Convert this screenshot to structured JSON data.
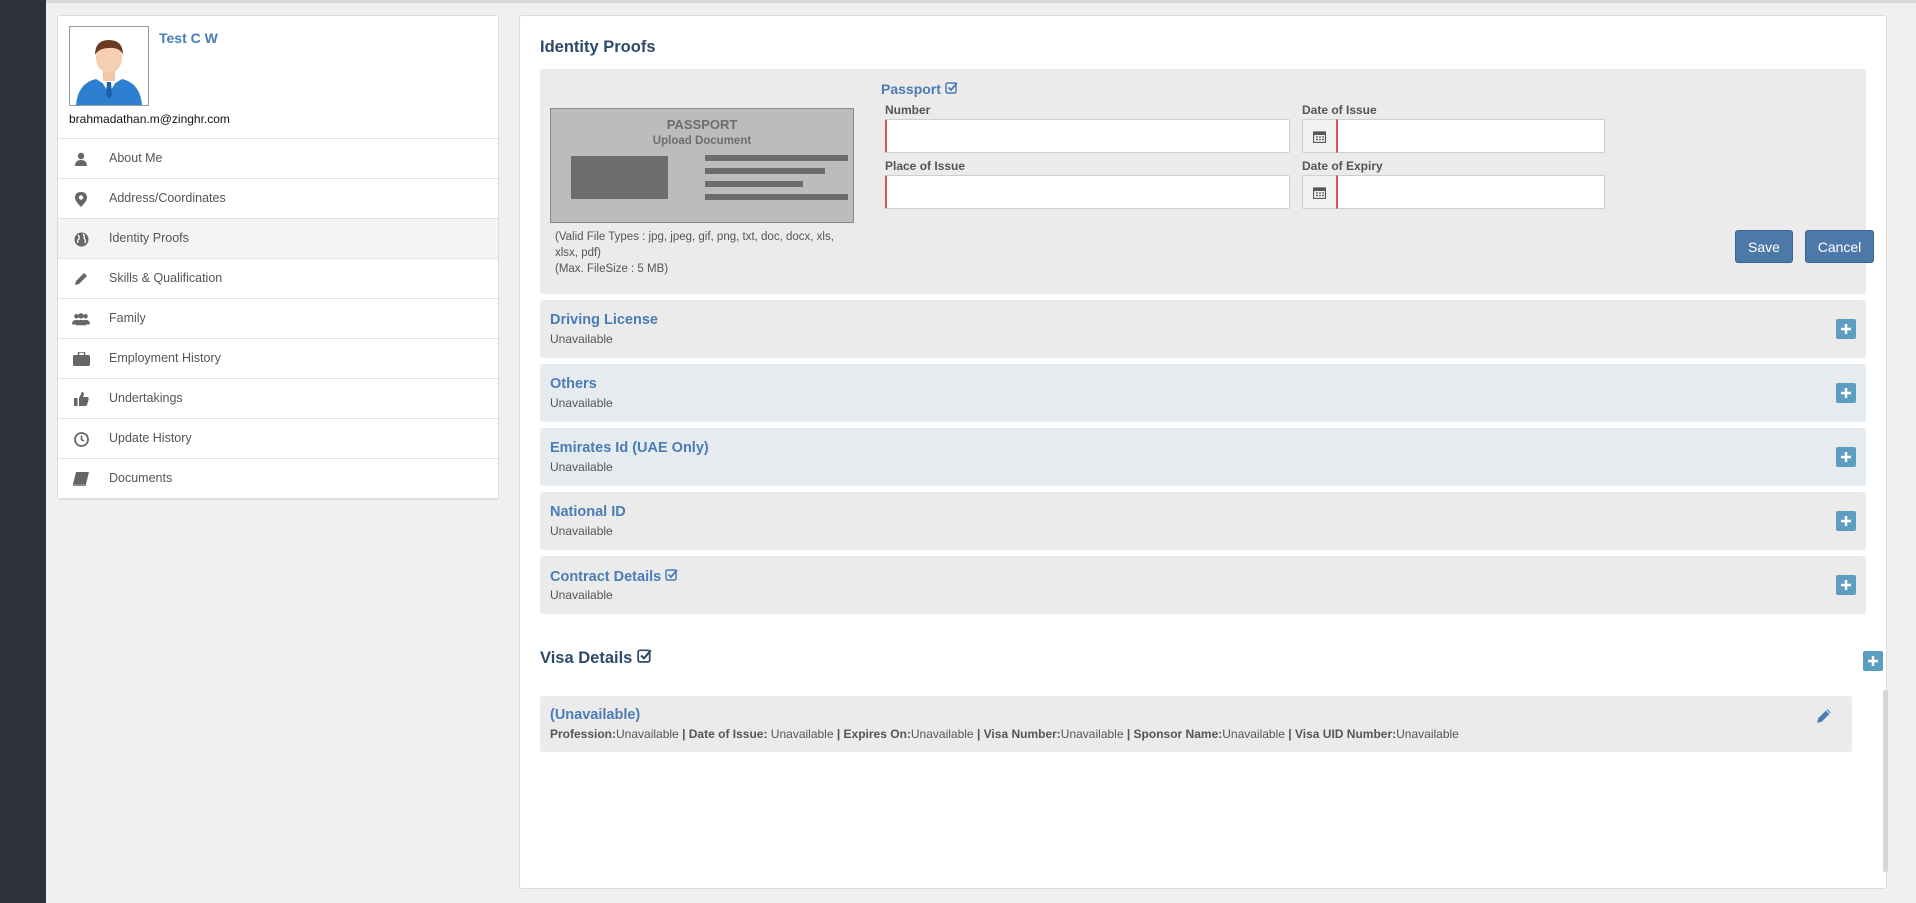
{
  "profile": {
    "name": "Test C W",
    "email": "brahmadathan.m@zinghr.com",
    "menu": [
      {
        "label": "About Me",
        "icon": "user-icon"
      },
      {
        "label": "Address/Coordinates",
        "icon": "map-marker-icon"
      },
      {
        "label": "Identity Proofs",
        "icon": "globe-icon",
        "active": true
      },
      {
        "label": "Skills & Qualification",
        "icon": "pencil-icon"
      },
      {
        "label": "Family",
        "icon": "users-icon"
      },
      {
        "label": "Employment History",
        "icon": "briefcase-icon"
      },
      {
        "label": "Undertakings",
        "icon": "thumbs-up-icon"
      },
      {
        "label": "Update History",
        "icon": "clock-icon"
      },
      {
        "label": "Documents",
        "icon": "book-icon"
      }
    ]
  },
  "main": {
    "title": "Identity Proofs",
    "passport": {
      "heading": "Passport",
      "card_title": "PASSPORT",
      "card_subtitle": "Upload Document",
      "file_types_note": "(Valid File Types : jpg, jpeg, gif, png, txt, doc, docx, xls, xlsx, pdf)",
      "file_size_note": "(Max. FileSize : 5 MB)",
      "labels": {
        "number": "Number",
        "date_of_issue": "Date of Issue",
        "place_of_issue": "Place of Issue",
        "date_of_expiry": "Date of Expiry"
      },
      "values": {
        "number": "",
        "date_of_issue": "",
        "place_of_issue": "",
        "date_of_expiry": ""
      },
      "save_label": "Save",
      "cancel_label": "Cancel"
    },
    "sections": [
      {
        "title": "Driving License",
        "status": "Unavailable",
        "checked": false
      },
      {
        "title": "Others",
        "status": "Unavailable",
        "checked": false
      },
      {
        "title": "Emirates Id (UAE Only)",
        "status": "Unavailable",
        "checked": false
      },
      {
        "title": "National ID",
        "status": "Unavailable",
        "checked": false
      },
      {
        "title": "Contract Details",
        "status": "Unavailable",
        "checked": true
      }
    ],
    "visa": {
      "title": "Visa Details",
      "entry_title": "(Unavailable)",
      "fields": [
        {
          "label": "Profession:",
          "value": "Unavailable"
        },
        {
          "label": "| Date of Issue:",
          "value": " Unavailable "
        },
        {
          "label": "| Expires On:",
          "value": "Unavailable"
        },
        {
          "label": "| Visa Number:",
          "value": "Unavailable"
        },
        {
          "label": "| Sponsor Name:",
          "value": "Unavailable"
        },
        {
          "label": "| Visa UID Number:",
          "value": "Unavailable"
        }
      ]
    }
  },
  "colors": {
    "accent": "#4a7db5",
    "button": "#4d79a8",
    "plus": "#5b9ec2",
    "required": "#d9534f",
    "rail": "#2d3139"
  }
}
